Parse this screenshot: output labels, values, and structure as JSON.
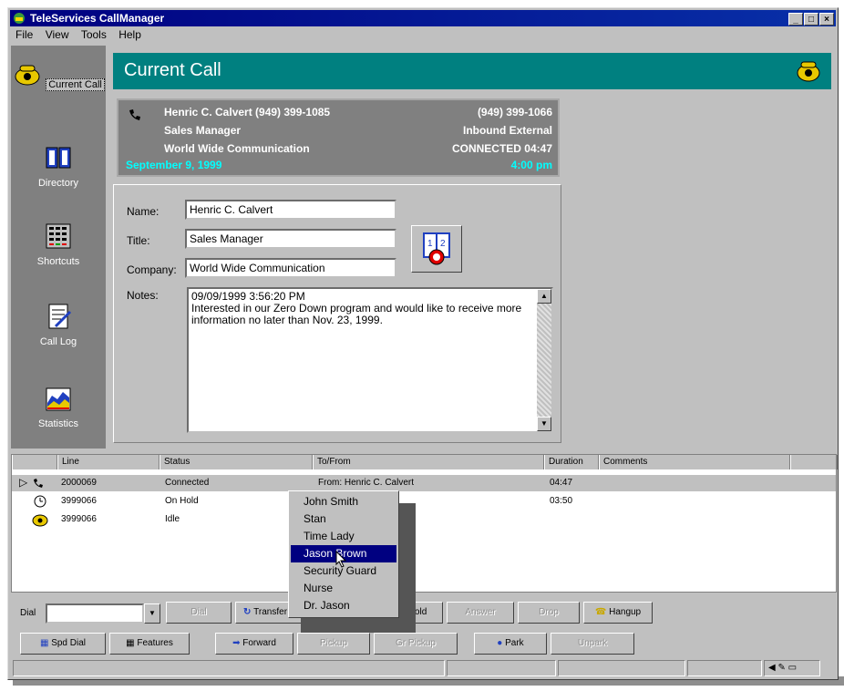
{
  "window": {
    "title": "TeleServices CallManager",
    "buttons": [
      "_",
      "□",
      "×"
    ]
  },
  "menu": [
    "File",
    "View",
    "Tools",
    "Help"
  ],
  "sidebar": {
    "items": [
      {
        "label": "Current Call",
        "icon": "phone-icon"
      },
      {
        "label": "Directory",
        "icon": "book-icon"
      },
      {
        "label": "Shortcuts",
        "icon": "grid-icon"
      },
      {
        "label": "Call Log",
        "icon": "notepad-icon"
      },
      {
        "label": "Statistics",
        "icon": "chart-icon"
      }
    ]
  },
  "header": {
    "title": "Current Call"
  },
  "call_info": {
    "caller": "Henric C. Calvert  (949) 399-1085",
    "number": "(949) 399-1066",
    "position": "Sales Manager",
    "direction": "Inbound External",
    "company": "World Wide Communication",
    "status": "CONNECTED 04:47",
    "date": "September 9, 1999",
    "time": "4:00 pm"
  },
  "form": {
    "name_label": "Name:",
    "name_value": "Henric C. Calvert",
    "title_label": "Title:",
    "title_value": "Sales Manager",
    "company_label": "Company:",
    "company_value": "World Wide Communication",
    "notes_label": "Notes:",
    "notes_lines": [
      "09/09/1999 3:56:20 PM",
      "Interested in our Zero Down program and would like to receive more",
      "information no later than Nov. 23, 1999."
    ]
  },
  "grid": {
    "columns": [
      "Line",
      "Status",
      "To/From",
      "Duration",
      "Comments"
    ],
    "rows": [
      {
        "line": "2000069",
        "status": "Connected",
        "tofrom": "From: Henric C. Calvert",
        "duration": "04:47"
      },
      {
        "line": "3999066",
        "status": "On Hold",
        "tofrom": "",
        "duration": "03:50"
      },
      {
        "line": "3999066",
        "status": "Idle",
        "tofrom": "",
        "duration": ""
      }
    ]
  },
  "popup_menu": [
    "John Smith",
    "Stan",
    "Time Lady",
    "Jason Brown",
    "Security Guard",
    "Nurse",
    "Dr. Jason"
  ],
  "popup_selected": 3,
  "toolbar1": {
    "dial_label": "Dial",
    "btn_dial": "Dial",
    "btn_transfer": "Transfer",
    "btn_hold": "Hold",
    "btn_answer": "Answer",
    "btn_drop": "Drop",
    "btn_hangup": "Hangup"
  },
  "toolbar2": {
    "btn_spd_dial": "Spd Dial",
    "btn_features": "Features",
    "btn_forward": "Forward",
    "btn_pickup": "Pickup",
    "btn_grpickup": "Gr Pickup",
    "btn_park": "Park",
    "btn_unpark": "Unpark"
  },
  "colors": {
    "teal": "#008080",
    "navy": "#000080",
    "cyan": "#00ffff",
    "gray": "#808080"
  }
}
